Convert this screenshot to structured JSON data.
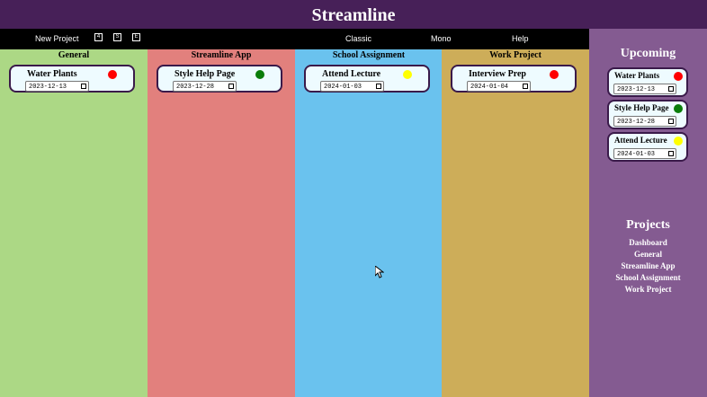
{
  "app": {
    "title": "Streamline"
  },
  "toolbar": {
    "new_project": "New Project",
    "icons": [
      {
        "name": "icon-4",
        "glyph": "4"
      },
      {
        "name": "icon-s",
        "glyph": "S"
      },
      {
        "name": "icon-e",
        "glyph": "E"
      }
    ],
    "theme_classic": "Classic",
    "theme_mono": "Mono",
    "help": "Help"
  },
  "columns": [
    {
      "title": "General",
      "color": "#acd885",
      "card": {
        "title": "Water Plants",
        "date": "2023-12-13",
        "status_color": "#ff0000"
      }
    },
    {
      "title": "Streamline App",
      "color": "#e2807d",
      "card": {
        "title": "Style Help Page",
        "date": "2023-12-28",
        "status_color": "#0a7d0a"
      }
    },
    {
      "title": "School Assignment",
      "color": "#6ac2ee",
      "card": {
        "title": "Attend Lecture",
        "date": "2024-01-03",
        "status_color": "#ffff00"
      }
    },
    {
      "title": "Work Project",
      "color": "#cdad59",
      "card": {
        "title": "Interview Prep",
        "date": "2024-01-04",
        "status_color": "#ff0000"
      }
    }
  ],
  "sidebar": {
    "upcoming_title": "Upcoming",
    "upcoming": [
      {
        "title": "Water Plants",
        "date": "2023-12-13",
        "status_color": "#ff0000"
      },
      {
        "title": "Style Help Page",
        "date": "2023-12-28",
        "status_color": "#0a7d0a"
      },
      {
        "title": "Attend Lecture",
        "date": "2024-01-03",
        "status_color": "#ffff00"
      }
    ],
    "projects_title": "Projects",
    "projects": [
      "Dashboard",
      "General",
      "Streamline App",
      "School Assignment",
      "Work Project"
    ]
  },
  "colors": {
    "header": "#472058",
    "sidebar": "#845b91",
    "toolbar": "#000000"
  }
}
